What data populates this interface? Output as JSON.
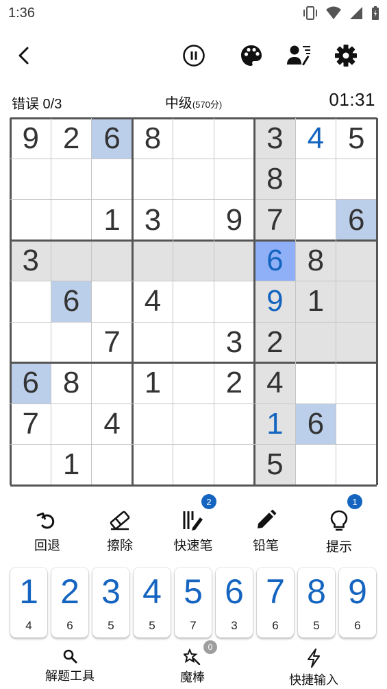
{
  "status_bar": {
    "time": "1:36"
  },
  "header": {
    "icons": [
      "back-arrow-icon",
      "pause-icon",
      "palette-icon",
      "profile-icon",
      "settings-gear-icon"
    ]
  },
  "game_info": {
    "mistakes": "错误 0/3",
    "difficulty": "中级",
    "difficulty_score": "(570分)",
    "timer": "01:31"
  },
  "board": {
    "rows": [
      [
        "9",
        "2",
        "6",
        "8",
        "",
        "",
        "3",
        "4",
        "5"
      ],
      [
        "",
        "",
        "",
        "",
        "",
        "",
        "8",
        "",
        ""
      ],
      [
        "",
        "",
        "1",
        "3",
        "",
        "9",
        "7",
        "",
        "6"
      ],
      [
        "3",
        "",
        "",
        "",
        "",
        "",
        "6",
        "8",
        ""
      ],
      [
        "",
        "6",
        "",
        "4",
        "",
        "",
        "9",
        "1",
        ""
      ],
      [
        "",
        "",
        "7",
        "",
        "",
        "3",
        "2",
        "",
        ""
      ],
      [
        "6",
        "8",
        "",
        "1",
        "",
        "2",
        "4",
        "",
        ""
      ],
      [
        "7",
        "",
        "4",
        "",
        "",
        "",
        "1",
        "6",
        ""
      ],
      [
        "",
        "1",
        "",
        "",
        "",
        "",
        "5",
        "",
        ""
      ]
    ],
    "user_entered": [
      [
        0,
        7
      ],
      [
        3,
        6
      ],
      [
        4,
        6
      ],
      [
        7,
        6
      ]
    ],
    "selected_cell": [
      3,
      6
    ],
    "highlight_same_number": [
      [
        0,
        2
      ],
      [
        2,
        8
      ],
      [
        4,
        1
      ],
      [
        6,
        0
      ],
      [
        7,
        7
      ]
    ],
    "highlight_color": "#bccfea",
    "selected_color": "#8fb0f7",
    "region_highlight_color": "#e2e2e2",
    "given_color": "#333333",
    "user_color": "#1565c0"
  },
  "tools": [
    {
      "label": "回退",
      "icon": "undo-icon"
    },
    {
      "label": "擦除",
      "icon": "eraser-icon"
    },
    {
      "label": "快速笔",
      "icon": "quick-pencil-icon",
      "badge": "2"
    },
    {
      "label": "铅笔",
      "icon": "pencil-icon"
    },
    {
      "label": "提示",
      "icon": "lightbulb-icon",
      "badge": "1"
    }
  ],
  "numpad": [
    {
      "digit": "1",
      "remaining": "4"
    },
    {
      "digit": "2",
      "remaining": "6"
    },
    {
      "digit": "3",
      "remaining": "5"
    },
    {
      "digit": "4",
      "remaining": "5"
    },
    {
      "digit": "5",
      "remaining": "7"
    },
    {
      "digit": "6",
      "remaining": "3"
    },
    {
      "digit": "7",
      "remaining": "6"
    },
    {
      "digit": "8",
      "remaining": "5"
    },
    {
      "digit": "9",
      "remaining": "6"
    }
  ],
  "bottom_nav": [
    {
      "label": "解题工具",
      "icon": "search-icon"
    },
    {
      "label": "魔棒",
      "icon": "magic-wand-icon",
      "badge": "0"
    },
    {
      "label": "快捷输入",
      "icon": "lightning-icon"
    }
  ]
}
